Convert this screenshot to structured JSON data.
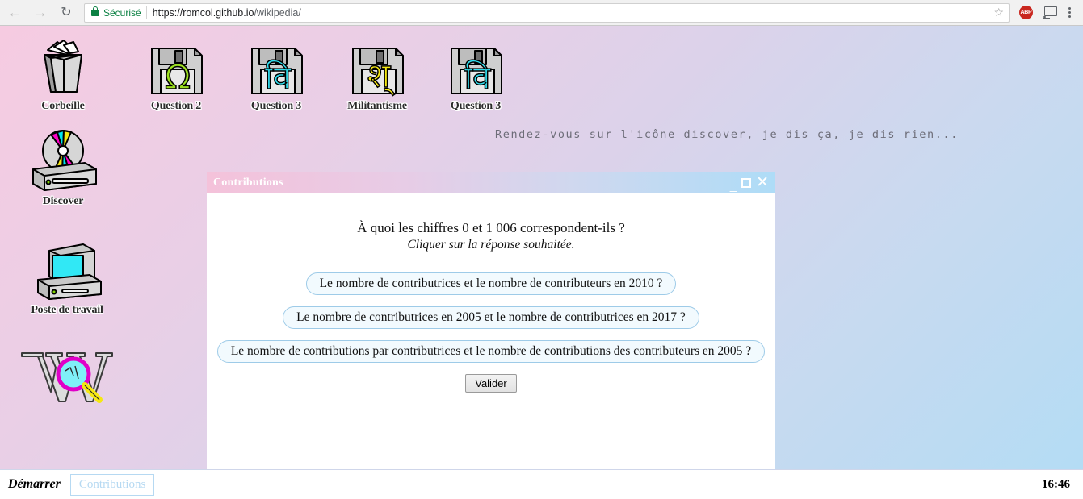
{
  "browser": {
    "back_icon": "back-arrow-icon",
    "forward_icon": "forward-arrow-icon",
    "reload_icon": "reload-icon",
    "security_label": "Sécurisé",
    "url_scheme_host": "https://romcol.github.io",
    "url_path": "/wikipedia/",
    "url_full": "https://romcol.github.io/wikipedia/",
    "star_glyph": "☆",
    "abp_label": "ABP",
    "cast_icon": "cast-icon",
    "menu_icon": "kebab-menu-icon"
  },
  "desktop": {
    "banner": "Rendez-vous sur l'icône discover, je dis ça, je dis rien...",
    "icons": [
      {
        "label": "Corbeille",
        "art": "trash-bin"
      },
      {
        "label": "Question 2",
        "art": "floppy",
        "glyph": "Ω",
        "glyph_color": "#9ce020"
      },
      {
        "label": "Question 3",
        "art": "floppy",
        "glyph": "वि",
        "glyph_color": "#31e0f0"
      },
      {
        "label": "Militantisme",
        "art": "floppy",
        "glyph": "श्",
        "glyph_color": "#f5e811"
      },
      {
        "label": "Question 3",
        "art": "floppy",
        "glyph": "वि",
        "glyph_color": "#31e0f0"
      },
      {
        "label": "Discover",
        "art": "cd-drive"
      },
      {
        "label": "Poste de travail",
        "art": "computer"
      },
      {
        "label": "",
        "art": "wikipedia-search"
      }
    ]
  },
  "window": {
    "title": "Contributions",
    "controls": {
      "minimize": "_",
      "maximize": "□",
      "close": "✕"
    },
    "question": "À quoi les chiffres 0 et 1 006 correspondent-ils ?",
    "instruction": "Cliquer sur la réponse souhaitée.",
    "answers": [
      "Le nombre de contributrices et le nombre de contributeurs en 2010 ?",
      "Le nombre de contributrices en 2005 et le nombre de contributrices en 2017 ?",
      "Le nombre de contributions par contributrices et le nombre de contributions des contributeurs en 2005 ?"
    ],
    "validate_label": "Valider"
  },
  "taskbar": {
    "start_label": "Démarrer",
    "tasks": [
      "Contributions"
    ],
    "clock": "16:46"
  },
  "colors": {
    "secure_green": "#0b8043",
    "desktop_pink": "#f6cbe1",
    "desktop_blue": "#b4dcf4",
    "pill_border": "#9ecbe8",
    "taskbar_task": "#b6d9f2"
  }
}
